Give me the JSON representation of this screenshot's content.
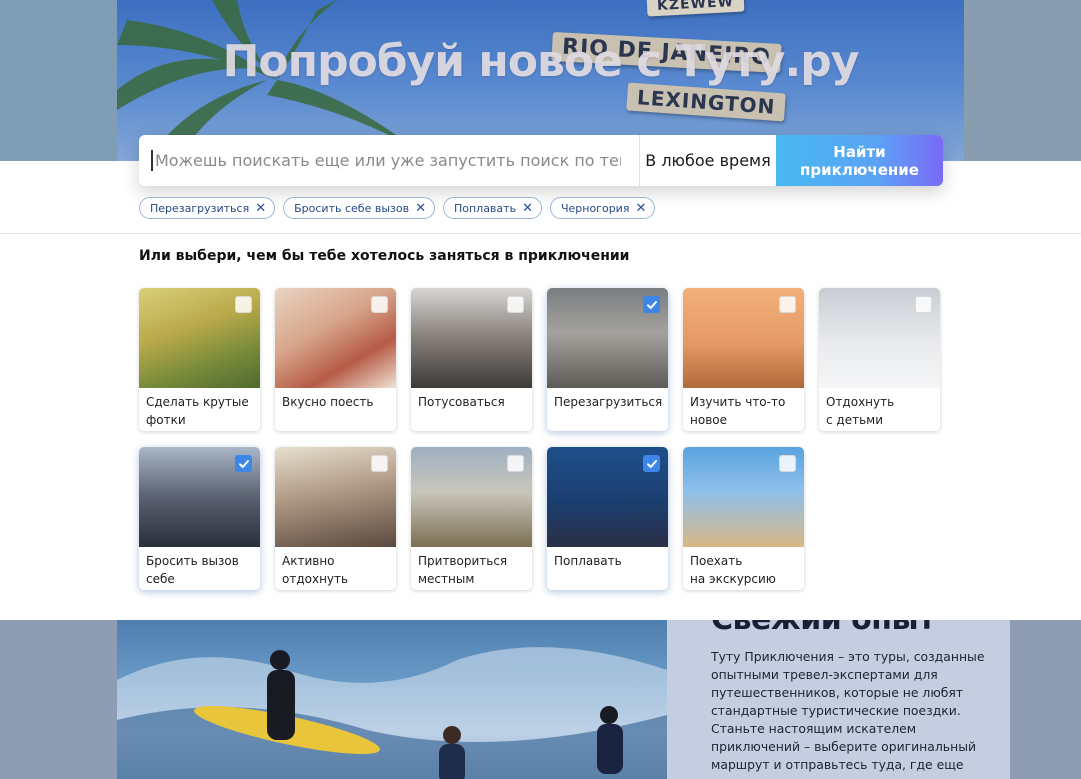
{
  "hero": {
    "title": "Попробуй новое с Туту.ру",
    "signs": [
      "RIO DE JANEIRO",
      "LEXINGTON",
      "KZEWEW"
    ]
  },
  "search": {
    "placeholder": "Можешь поискать еще или уже запустить поиск по тегам",
    "value": "",
    "time_label": "В любое время",
    "button_label": "Найти приключение"
  },
  "tags": [
    {
      "label": "Перезагрузиться"
    },
    {
      "label": "Бросить себе вызов"
    },
    {
      "label": "Поплавать"
    },
    {
      "label": "Черногория"
    }
  ],
  "section": {
    "title": "Или выбери, чем бы тебе хотелось заняться в приключении"
  },
  "cards": [
    {
      "label": "Сделать крутые\nфотки",
      "checked": false,
      "icon": "camera-photo"
    },
    {
      "label": "Вкусно поесть",
      "checked": false,
      "icon": "food-photo"
    },
    {
      "label": "Потусоваться",
      "checked": false,
      "icon": "shopping-photo"
    },
    {
      "label": "Перезагрузиться",
      "checked": true,
      "icon": "yoga-photo"
    },
    {
      "label": "Изучить что-то\nновое",
      "checked": false,
      "icon": "giraffe-photo"
    },
    {
      "label": "Отдохнуть\nс детьми",
      "checked": false,
      "icon": "snow-kids-photo"
    },
    {
      "label": "Бросить вызов\nсебе",
      "checked": true,
      "icon": "ski-lift-photo"
    },
    {
      "label": "Активно отдохнуть",
      "checked": false,
      "icon": "car-couple-photo"
    },
    {
      "label": "Притвориться\nместным",
      "checked": false,
      "icon": "hiking-photo"
    },
    {
      "label": "Поплавать",
      "checked": true,
      "icon": "diving-photo"
    },
    {
      "label": "Поехать\nна экскурсию",
      "checked": false,
      "icon": "excursion-photo"
    }
  ],
  "promo": {
    "title": "Свежий опыт",
    "body": "Туту Приключения – это туры, созданные опытными тревел-экспертами для путешественников, которые не любят стандартные туристические поездки. Станьте настоящим искателем приключений – выберите оригинальный маршрут и отправьтесь туда, где еще"
  },
  "colors": {
    "accent": "#3d86e8",
    "tag_text": "#274a87",
    "button_gradient_start": "#48b9f1",
    "button_gradient_end": "#7a6af5"
  }
}
